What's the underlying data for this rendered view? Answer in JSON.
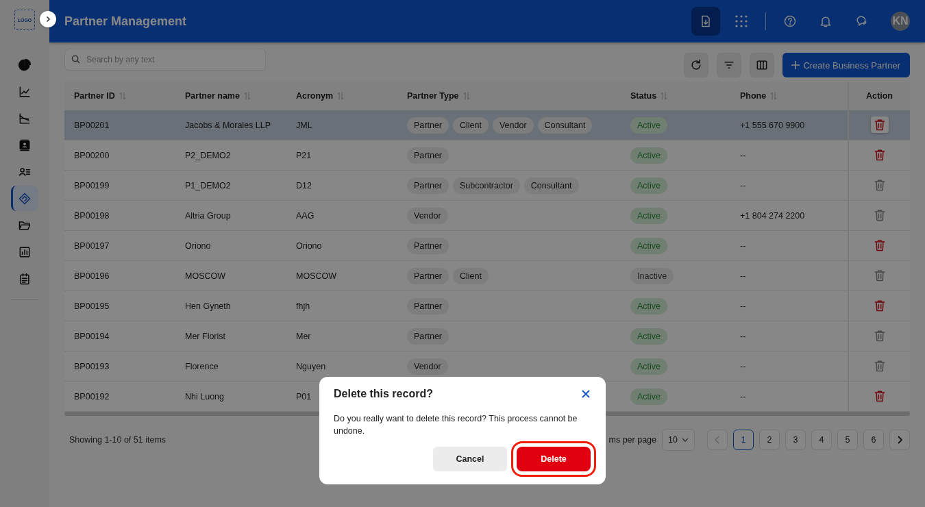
{
  "sidebar": {
    "logo": "LOGO",
    "items": [
      {
        "selected": false
      },
      {
        "selected": false
      },
      {
        "selected": false
      },
      {
        "selected": false
      },
      {
        "selected": false
      },
      {
        "selected": true
      },
      {
        "selected": false
      },
      {
        "selected": false
      },
      {
        "selected": false
      }
    ]
  },
  "header": {
    "title": "Partner Management",
    "avatar": "KN"
  },
  "toolbar": {
    "search_placeholder": "Search by any text",
    "create_button": "Create Business Partner"
  },
  "table": {
    "columns": [
      {
        "label": "Partner ID",
        "sortable": true
      },
      {
        "label": "Partner name",
        "sortable": true
      },
      {
        "label": "Acronym",
        "sortable": true
      },
      {
        "label": "Partner Type",
        "sortable": true
      },
      {
        "label": "Status",
        "sortable": true
      },
      {
        "label": "Phone",
        "sortable": true
      },
      {
        "label": "Action",
        "sortable": false
      }
    ],
    "rows": [
      {
        "id": "BP00201",
        "name": "Jacobs & Morales LLP",
        "acronym": "JML",
        "types": [
          "Partner",
          "Client",
          "Vendor",
          "Consultant"
        ],
        "status": "Active",
        "active": true,
        "phone": "+1 555 670 9900",
        "deletable": true,
        "selected": true
      },
      {
        "id": "BP00200",
        "name": "P2_DEMO2",
        "acronym": "P21",
        "types": [
          "Partner"
        ],
        "status": "Active",
        "active": true,
        "phone": "--",
        "deletable": true,
        "selected": false
      },
      {
        "id": "BP00199",
        "name": "P1_DEMO2",
        "acronym": "D12",
        "types": [
          "Partner",
          "Subcontractor",
          "Consultant"
        ],
        "status": "Active",
        "active": true,
        "phone": "--",
        "deletable": false,
        "selected": false
      },
      {
        "id": "BP00198",
        "name": "Altria Group",
        "acronym": "AAG",
        "types": [
          "Vendor"
        ],
        "status": "Active",
        "active": true,
        "phone": "+1 804 274 2200",
        "deletable": false,
        "selected": false
      },
      {
        "id": "BP00197",
        "name": "Oriono",
        "acronym": "Oriono",
        "types": [
          "Partner"
        ],
        "status": "Active",
        "active": true,
        "phone": "--",
        "deletable": true,
        "selected": false
      },
      {
        "id": "BP00196",
        "name": "MOSCOW",
        "acronym": "MOSCOW",
        "types": [
          "Partner",
          "Client"
        ],
        "status": "Inactive",
        "active": false,
        "phone": "--",
        "deletable": false,
        "selected": false
      },
      {
        "id": "BP00195",
        "name": "Hen Gyneth",
        "acronym": "fhjh",
        "types": [
          "Partner"
        ],
        "status": "Active",
        "active": true,
        "phone": "--",
        "deletable": true,
        "selected": false
      },
      {
        "id": "BP00194",
        "name": "Mer Florist",
        "acronym": "Mer",
        "types": [
          "Partner"
        ],
        "status": "Active",
        "active": true,
        "phone": "--",
        "deletable": false,
        "selected": false
      },
      {
        "id": "BP00193",
        "name": "Florence",
        "acronym": "Nguyen",
        "types": [
          "Vendor"
        ],
        "status": "Active",
        "active": true,
        "phone": "--",
        "deletable": false,
        "selected": false
      },
      {
        "id": "BP00192",
        "name": "Nhi Luong",
        "acronym": "P01",
        "types": [],
        "status": "Active",
        "active": true,
        "phone": "--",
        "deletable": true,
        "selected": false
      }
    ]
  },
  "footer": {
    "summary": "Showing 1-10 of 51 items",
    "per_page_label": "ms per page",
    "per_page": "10",
    "prev_disabled": true,
    "pages": [
      {
        "label": "1",
        "selected": true
      },
      {
        "label": "2",
        "selected": false
      },
      {
        "label": "3",
        "selected": false
      },
      {
        "label": "4",
        "selected": false
      },
      {
        "label": "5",
        "selected": false
      },
      {
        "label": "6",
        "selected": false
      }
    ]
  },
  "dialog": {
    "title": "Delete this record?",
    "message": "Do you really want to delete this record? This process cannot be undone.",
    "cancel": "Cancel",
    "confirm": "Delete",
    "confirm_highlighted": true
  }
}
